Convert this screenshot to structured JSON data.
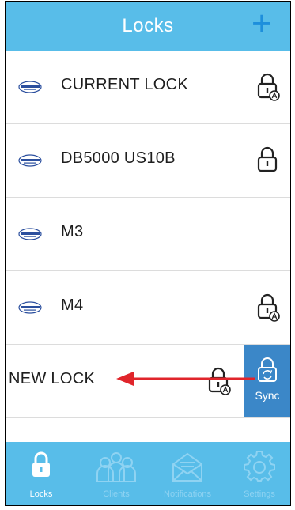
{
  "header": {
    "title": "Locks",
    "add_icon_glyph": "+"
  },
  "rows": [
    {
      "name": "CURRENT LOCK",
      "logo": "brand-logo",
      "lock_icon": "lock-auto-icon"
    },
    {
      "name": "DB5000 US10B",
      "logo": "brand-logo",
      "lock_icon": "lock-icon"
    },
    {
      "name": "M3",
      "logo": "brand-logo",
      "lock_icon": ""
    },
    {
      "name": "M4",
      "logo": "brand-logo",
      "lock_icon": "lock-auto-icon"
    },
    {
      "name": "NEW LOCK",
      "logo": "",
      "lock_icon": "lock-auto-icon"
    }
  ],
  "sync_button": {
    "label": "Sync",
    "icon": "sync-icon"
  },
  "tabs": [
    {
      "label": "Locks",
      "icon": "lock-icon",
      "active": true
    },
    {
      "label": "Clients",
      "icon": "users-icon",
      "active": false
    },
    {
      "label": "Notifications",
      "icon": "envelope-icon",
      "active": false
    },
    {
      "label": "Settings",
      "icon": "gear-icon",
      "active": false
    }
  ],
  "colors": {
    "header_bg": "#58bde9",
    "tabbar_bg": "#58bde9",
    "add_icon": "#1d8fdc",
    "sync_bg": "#3b87c8",
    "annotation_arrow": "#e0252b"
  }
}
